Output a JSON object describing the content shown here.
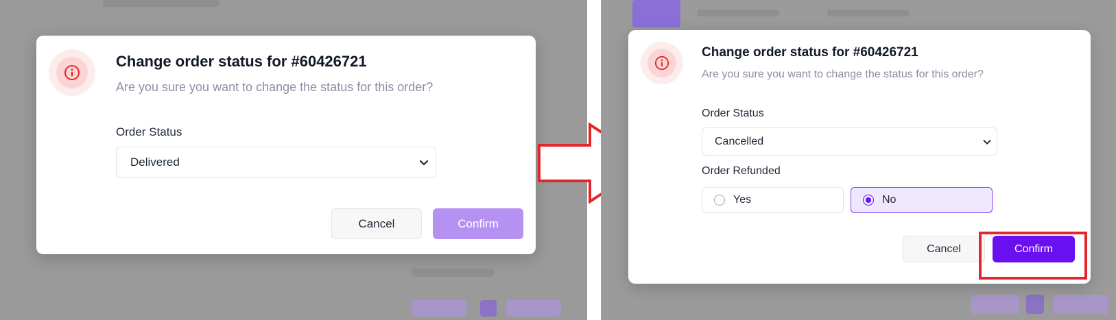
{
  "left": {
    "modal": {
      "title": "Change order status for #60426721",
      "subtitle": "Are you sure you want to change the status for this order?",
      "order_status_label": "Order Status",
      "order_status_value": "Delivered",
      "cancel_label": "Cancel",
      "confirm_label": "Confirm",
      "confirm_enabled": false
    }
  },
  "right": {
    "modal": {
      "title": "Change order status for #60426721",
      "subtitle": "Are you sure you want to change the status for this order?",
      "order_status_label": "Order Status",
      "order_status_value": "Cancelled",
      "order_refunded_label": "Order Refunded",
      "refund_options": [
        {
          "label": "Yes",
          "selected": false
        },
        {
          "label": "No",
          "selected": true
        }
      ],
      "cancel_label": "Cancel",
      "confirm_label": "Confirm",
      "confirm_enabled": true
    }
  },
  "icons": {
    "info": "info-icon",
    "dropdown": "chevron-down-icon",
    "transition": "right-arrow-icon"
  },
  "colors": {
    "accent": "#6a10f0",
    "accent_disabled": "#b592f2",
    "danger": "#e3262b",
    "backdrop": "#9a9a9a"
  }
}
